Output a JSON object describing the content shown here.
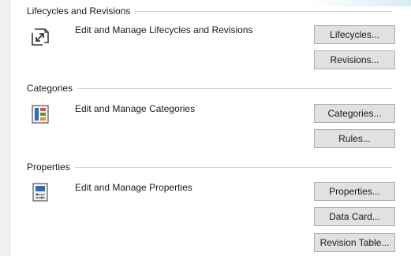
{
  "sections": {
    "lifecycles": {
      "title": "Lifecycles and Revisions",
      "description": "Edit and Manage Lifecycles and Revisions",
      "icon": "lifecycle-arrows-icon",
      "buttons": [
        "Lifecycles...",
        "Revisions..."
      ]
    },
    "categories": {
      "title": "Categories",
      "description": "Edit and Manage Categories",
      "icon": "categories-icon",
      "buttons": [
        "Categories...",
        "Rules..."
      ]
    },
    "properties": {
      "title": "Properties",
      "description": "Edit and Manage Properties",
      "icon": "properties-icon",
      "buttons": [
        "Properties...",
        "Data Card...",
        "Revision Table..."
      ]
    }
  },
  "colors": {
    "button_face": "#e1e1e1",
    "button_border": "#adadad",
    "icon_blue": "#2e6eb5",
    "icon_red": "#d9534f",
    "icon_green": "#4a9d3a",
    "icon_orange": "#e8902a"
  }
}
